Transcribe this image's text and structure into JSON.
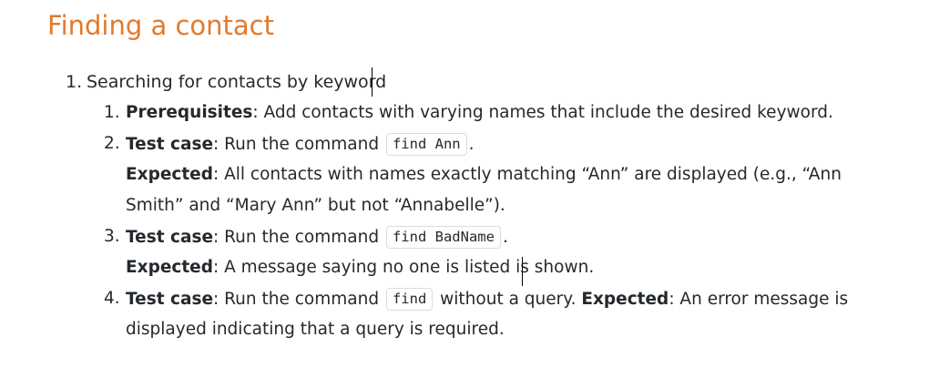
{
  "title": "Finding a contact",
  "section": {
    "number": "1.",
    "heading": "Searching for contacts by keyword",
    "items": [
      {
        "number": "1.",
        "label": "Prerequisites",
        "colon": ":",
        "text": " Add contacts with varying names that include the desired keyword."
      },
      {
        "number": "2.",
        "label": "Test case",
        "colon": ":",
        "before_code": " Run the command ",
        "code": "find Ann",
        "after_code": ".",
        "expected_label": "Expected",
        "expected_colon": ":",
        "expected_text_1": " All contacts with names exactly matching “Ann” are displayed (e.g., “Ann",
        "expected_text_2": "Smith” and “Mary Ann” but not “Annabelle”)."
      },
      {
        "number": "3.",
        "label": "Test case",
        "colon": ":",
        "before_code": " Run the command ",
        "code": "find BadName",
        "after_code": ".",
        "expected_label": "Expected",
        "expected_colon": ":",
        "expected_text": " A message saying no one is listed is shown."
      },
      {
        "number": "4.",
        "label": "Test case",
        "colon": ":",
        "before_code": " Run the command ",
        "code": "find",
        "after_code": " without a query. ",
        "expected_label": "Expected",
        "expected_colon": ":",
        "expected_text_1": " An error message is",
        "expected_text_2": "displayed indicating that a query is required."
      }
    ]
  }
}
